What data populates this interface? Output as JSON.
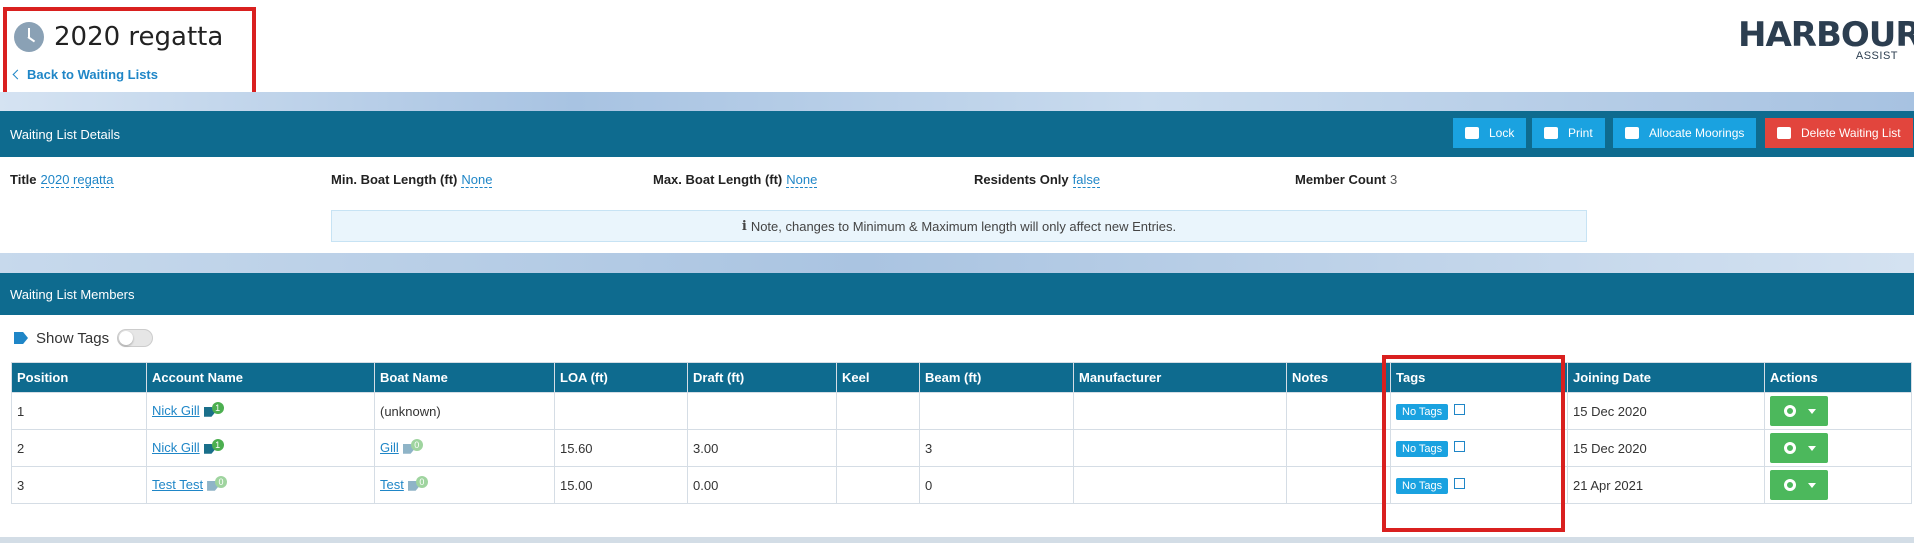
{
  "page": {
    "title": "2020 regatta",
    "back_link": "Back to Waiting Lists",
    "logo_main": "HARBOUR",
    "logo_sub": "ASSIST"
  },
  "details_panel": {
    "heading": "Waiting List Details",
    "buttons": {
      "lock": "Lock",
      "print": "Print",
      "allocate": "Allocate Moorings",
      "delete": "Delete Waiting List"
    },
    "fields": {
      "title_label": "Title",
      "title_value": "2020 regatta",
      "min_label": "Min. Boat Length (ft)",
      "min_value": "None",
      "max_label": "Max. Boat Length (ft)",
      "max_value": "None",
      "residents_label": "Residents Only",
      "residents_value": "false",
      "member_count_label": "Member Count",
      "member_count_value": "3"
    },
    "note": "Note, changes to Minimum & Maximum length will only affect new Entries."
  },
  "members_panel": {
    "heading": "Waiting List Members",
    "show_tags_label": "Show Tags",
    "columns": [
      "Position",
      "Account Name",
      "Boat Name",
      "LOA (ft)",
      "Draft (ft)",
      "Keel",
      "Beam (ft)",
      "Manufacturer",
      "Notes",
      "Tags",
      "Joining Date",
      "Actions"
    ],
    "rows": [
      {
        "position": "1",
        "account": "Nick Gill",
        "account_count": "1",
        "boat": "(unknown)",
        "boat_count": "",
        "loa": "",
        "draft": "",
        "keel": "",
        "beam": "",
        "manufacturer": "",
        "notes": "",
        "tags": "No Tags",
        "joining": "15 Dec 2020"
      },
      {
        "position": "2",
        "account": "Nick Gill",
        "account_count": "1",
        "boat": "Gill",
        "boat_count": "0",
        "loa": "15.60",
        "draft": "3.00",
        "keel": "",
        "beam": "3",
        "manufacturer": "",
        "notes": "",
        "tags": "No Tags",
        "joining": "15 Dec 2020"
      },
      {
        "position": "3",
        "account": "Test Test",
        "account_count": "0",
        "boat": "Test",
        "boat_count": "0",
        "loa": "15.00",
        "draft": "0.00",
        "keel": "",
        "beam": "0",
        "manufacturer": "",
        "notes": "",
        "tags": "No Tags",
        "joining": "21 Apr 2021"
      }
    ]
  },
  "colors": {
    "header_bar": "#0e6b8f",
    "button_blue": "#1aa2e0",
    "button_red": "#e2453d",
    "action_green": "#4cb85c",
    "link": "#1f86c7",
    "highlight_red": "#d9201f"
  }
}
